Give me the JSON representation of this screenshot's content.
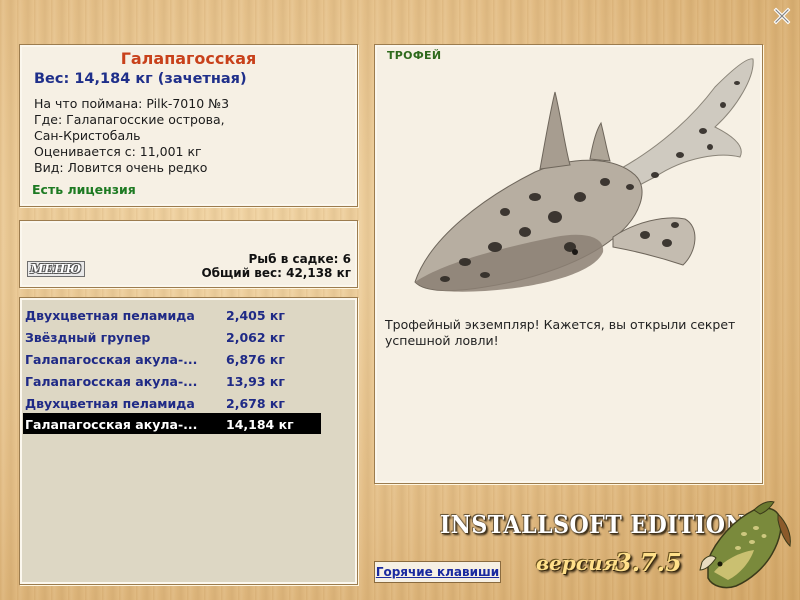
{
  "window": {
    "close_glyph": "X"
  },
  "fish_info": {
    "title": "Галапагосская",
    "weight": "Вес: 14,184 кг (зачетная)",
    "caught_on": "На что поймана: Pilk-7010 №3",
    "location_line1": "Где: Галапагосские острова,",
    "location_line2": "Сан-Кристобаль",
    "valued_from": "Оценивается с: 11,001 кг",
    "kind": "Вид: Ловится очень редко",
    "license": "Есть лицензия"
  },
  "keepnet": {
    "menu_label": "МЕНЮ",
    "fish_count": "Рыб в садке: 6",
    "total_weight": "Общий вес: 42,138 кг"
  },
  "catch_list": [
    {
      "name": "Двухцветная пеламида",
      "weight": "2,405 кг",
      "selected": false
    },
    {
      "name": "Звёздный групер",
      "weight": "2,062 кг",
      "selected": false
    },
    {
      "name": "Галапагосская акула-...",
      "weight": "6,876 кг",
      "selected": false
    },
    {
      "name": "Галапагосская акула-...",
      "weight": "13,93 кг",
      "selected": false
    },
    {
      "name": "Двухцветная пеламида",
      "weight": "2,678 кг",
      "selected": false
    },
    {
      "name": "Галапагосская акула-...",
      "weight": "14,184 кг",
      "selected": true
    }
  ],
  "trophy": {
    "label": "ТРОФЕЙ",
    "text": "Трофейный экземпляр! Кажется, вы открыли секрет успешной ловли!"
  },
  "footer": {
    "hotkeys": "Горячие клавиши",
    "edition": "INSTALLSOFT EDITION",
    "version_label": "версия",
    "version_number": "3.7.5"
  },
  "colors": {
    "title": "#c8411b",
    "weight": "#1f2f8a",
    "license": "#1d7a22",
    "selected_row": "#000000"
  },
  "icons": {
    "close": "close-icon",
    "trophy_image": "shark-image",
    "logo": "pike-fish-icon"
  }
}
